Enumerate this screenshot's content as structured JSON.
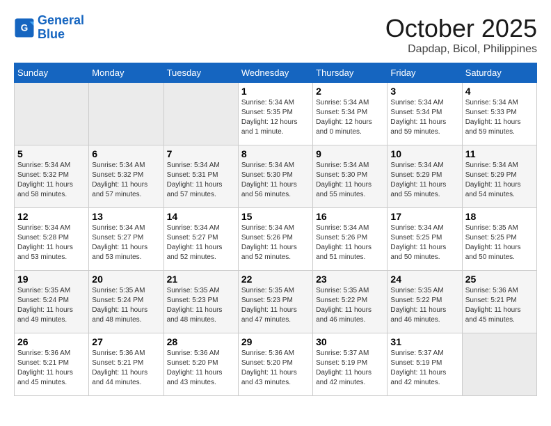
{
  "header": {
    "logo_line1": "General",
    "logo_line2": "Blue",
    "month": "October 2025",
    "location": "Dapdap, Bicol, Philippines"
  },
  "weekdays": [
    "Sunday",
    "Monday",
    "Tuesday",
    "Wednesday",
    "Thursday",
    "Friday",
    "Saturday"
  ],
  "weeks": [
    [
      {
        "day": "",
        "info": ""
      },
      {
        "day": "",
        "info": ""
      },
      {
        "day": "",
        "info": ""
      },
      {
        "day": "1",
        "info": "Sunrise: 5:34 AM\nSunset: 5:35 PM\nDaylight: 12 hours\nand 1 minute."
      },
      {
        "day": "2",
        "info": "Sunrise: 5:34 AM\nSunset: 5:34 PM\nDaylight: 12 hours\nand 0 minutes."
      },
      {
        "day": "3",
        "info": "Sunrise: 5:34 AM\nSunset: 5:34 PM\nDaylight: 11 hours\nand 59 minutes."
      },
      {
        "day": "4",
        "info": "Sunrise: 5:34 AM\nSunset: 5:33 PM\nDaylight: 11 hours\nand 59 minutes."
      }
    ],
    [
      {
        "day": "5",
        "info": "Sunrise: 5:34 AM\nSunset: 5:32 PM\nDaylight: 11 hours\nand 58 minutes."
      },
      {
        "day": "6",
        "info": "Sunrise: 5:34 AM\nSunset: 5:32 PM\nDaylight: 11 hours\nand 57 minutes."
      },
      {
        "day": "7",
        "info": "Sunrise: 5:34 AM\nSunset: 5:31 PM\nDaylight: 11 hours\nand 57 minutes."
      },
      {
        "day": "8",
        "info": "Sunrise: 5:34 AM\nSunset: 5:30 PM\nDaylight: 11 hours\nand 56 minutes."
      },
      {
        "day": "9",
        "info": "Sunrise: 5:34 AM\nSunset: 5:30 PM\nDaylight: 11 hours\nand 55 minutes."
      },
      {
        "day": "10",
        "info": "Sunrise: 5:34 AM\nSunset: 5:29 PM\nDaylight: 11 hours\nand 55 minutes."
      },
      {
        "day": "11",
        "info": "Sunrise: 5:34 AM\nSunset: 5:29 PM\nDaylight: 11 hours\nand 54 minutes."
      }
    ],
    [
      {
        "day": "12",
        "info": "Sunrise: 5:34 AM\nSunset: 5:28 PM\nDaylight: 11 hours\nand 53 minutes."
      },
      {
        "day": "13",
        "info": "Sunrise: 5:34 AM\nSunset: 5:27 PM\nDaylight: 11 hours\nand 53 minutes."
      },
      {
        "day": "14",
        "info": "Sunrise: 5:34 AM\nSunset: 5:27 PM\nDaylight: 11 hours\nand 52 minutes."
      },
      {
        "day": "15",
        "info": "Sunrise: 5:34 AM\nSunset: 5:26 PM\nDaylight: 11 hours\nand 52 minutes."
      },
      {
        "day": "16",
        "info": "Sunrise: 5:34 AM\nSunset: 5:26 PM\nDaylight: 11 hours\nand 51 minutes."
      },
      {
        "day": "17",
        "info": "Sunrise: 5:34 AM\nSunset: 5:25 PM\nDaylight: 11 hours\nand 50 minutes."
      },
      {
        "day": "18",
        "info": "Sunrise: 5:35 AM\nSunset: 5:25 PM\nDaylight: 11 hours\nand 50 minutes."
      }
    ],
    [
      {
        "day": "19",
        "info": "Sunrise: 5:35 AM\nSunset: 5:24 PM\nDaylight: 11 hours\nand 49 minutes."
      },
      {
        "day": "20",
        "info": "Sunrise: 5:35 AM\nSunset: 5:24 PM\nDaylight: 11 hours\nand 48 minutes."
      },
      {
        "day": "21",
        "info": "Sunrise: 5:35 AM\nSunset: 5:23 PM\nDaylight: 11 hours\nand 48 minutes."
      },
      {
        "day": "22",
        "info": "Sunrise: 5:35 AM\nSunset: 5:23 PM\nDaylight: 11 hours\nand 47 minutes."
      },
      {
        "day": "23",
        "info": "Sunrise: 5:35 AM\nSunset: 5:22 PM\nDaylight: 11 hours\nand 46 minutes."
      },
      {
        "day": "24",
        "info": "Sunrise: 5:35 AM\nSunset: 5:22 PM\nDaylight: 11 hours\nand 46 minutes."
      },
      {
        "day": "25",
        "info": "Sunrise: 5:36 AM\nSunset: 5:21 PM\nDaylight: 11 hours\nand 45 minutes."
      }
    ],
    [
      {
        "day": "26",
        "info": "Sunrise: 5:36 AM\nSunset: 5:21 PM\nDaylight: 11 hours\nand 45 minutes."
      },
      {
        "day": "27",
        "info": "Sunrise: 5:36 AM\nSunset: 5:21 PM\nDaylight: 11 hours\nand 44 minutes."
      },
      {
        "day": "28",
        "info": "Sunrise: 5:36 AM\nSunset: 5:20 PM\nDaylight: 11 hours\nand 43 minutes."
      },
      {
        "day": "29",
        "info": "Sunrise: 5:36 AM\nSunset: 5:20 PM\nDaylight: 11 hours\nand 43 minutes."
      },
      {
        "day": "30",
        "info": "Sunrise: 5:37 AM\nSunset: 5:19 PM\nDaylight: 11 hours\nand 42 minutes."
      },
      {
        "day": "31",
        "info": "Sunrise: 5:37 AM\nSunset: 5:19 PM\nDaylight: 11 hours\nand 42 minutes."
      },
      {
        "day": "",
        "info": ""
      }
    ]
  ]
}
